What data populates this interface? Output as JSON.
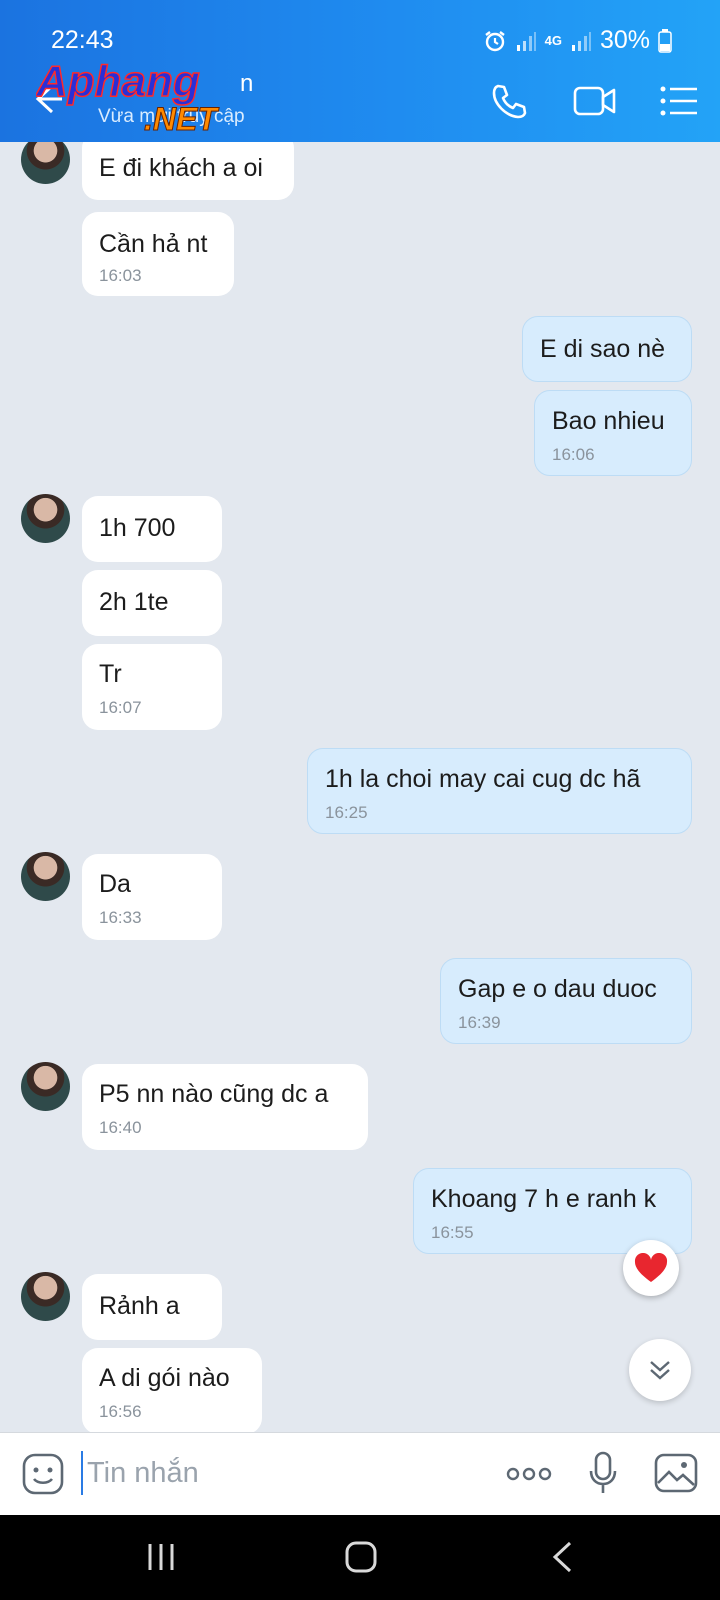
{
  "status": {
    "time": "22:43",
    "battery": "30%",
    "network": "4G"
  },
  "header": {
    "contact_name": "n",
    "last_seen": "Vừa mới truy cập",
    "logo_text_1": "Aphang",
    "logo_text_2": ".NET"
  },
  "messages": [
    {
      "side": "in",
      "text": "E đi khách a oi",
      "time": ""
    },
    {
      "side": "in",
      "text": "Cần hả nt",
      "time": "16:03"
    },
    {
      "side": "out",
      "text": "E di sao nè",
      "time": ""
    },
    {
      "side": "out",
      "text": "Bao nhieu",
      "time": "16:06"
    },
    {
      "side": "in",
      "text": "1h 700",
      "time": ""
    },
    {
      "side": "in",
      "text": "2h 1te",
      "time": ""
    },
    {
      "side": "in",
      "text": "Tr",
      "time": "16:07"
    },
    {
      "side": "out",
      "text": "1h la choi may cai cug dc hã",
      "time": "16:25"
    },
    {
      "side": "in",
      "text": "Da",
      "time": "16:33"
    },
    {
      "side": "out",
      "text": "Gap e o dau duoc",
      "time": "16:39"
    },
    {
      "side": "in",
      "text": "P5 nn nào cũng dc a",
      "time": "16:40"
    },
    {
      "side": "out",
      "text": "Khoang 7 h e ranh k",
      "time": "16:55"
    },
    {
      "side": "in",
      "text": "Rảnh a",
      "time": ""
    },
    {
      "side": "in",
      "text": "A di gói nào",
      "time": "16:56"
    }
  ],
  "composer": {
    "placeholder": "Tin nhắn"
  },
  "colors": {
    "header_start": "#1b73e0",
    "header_end": "#23a3f7",
    "outgoing_bubble": "#d7ecfd",
    "incoming_bubble": "#ffffff",
    "chat_bg": "#e3e8ef"
  }
}
